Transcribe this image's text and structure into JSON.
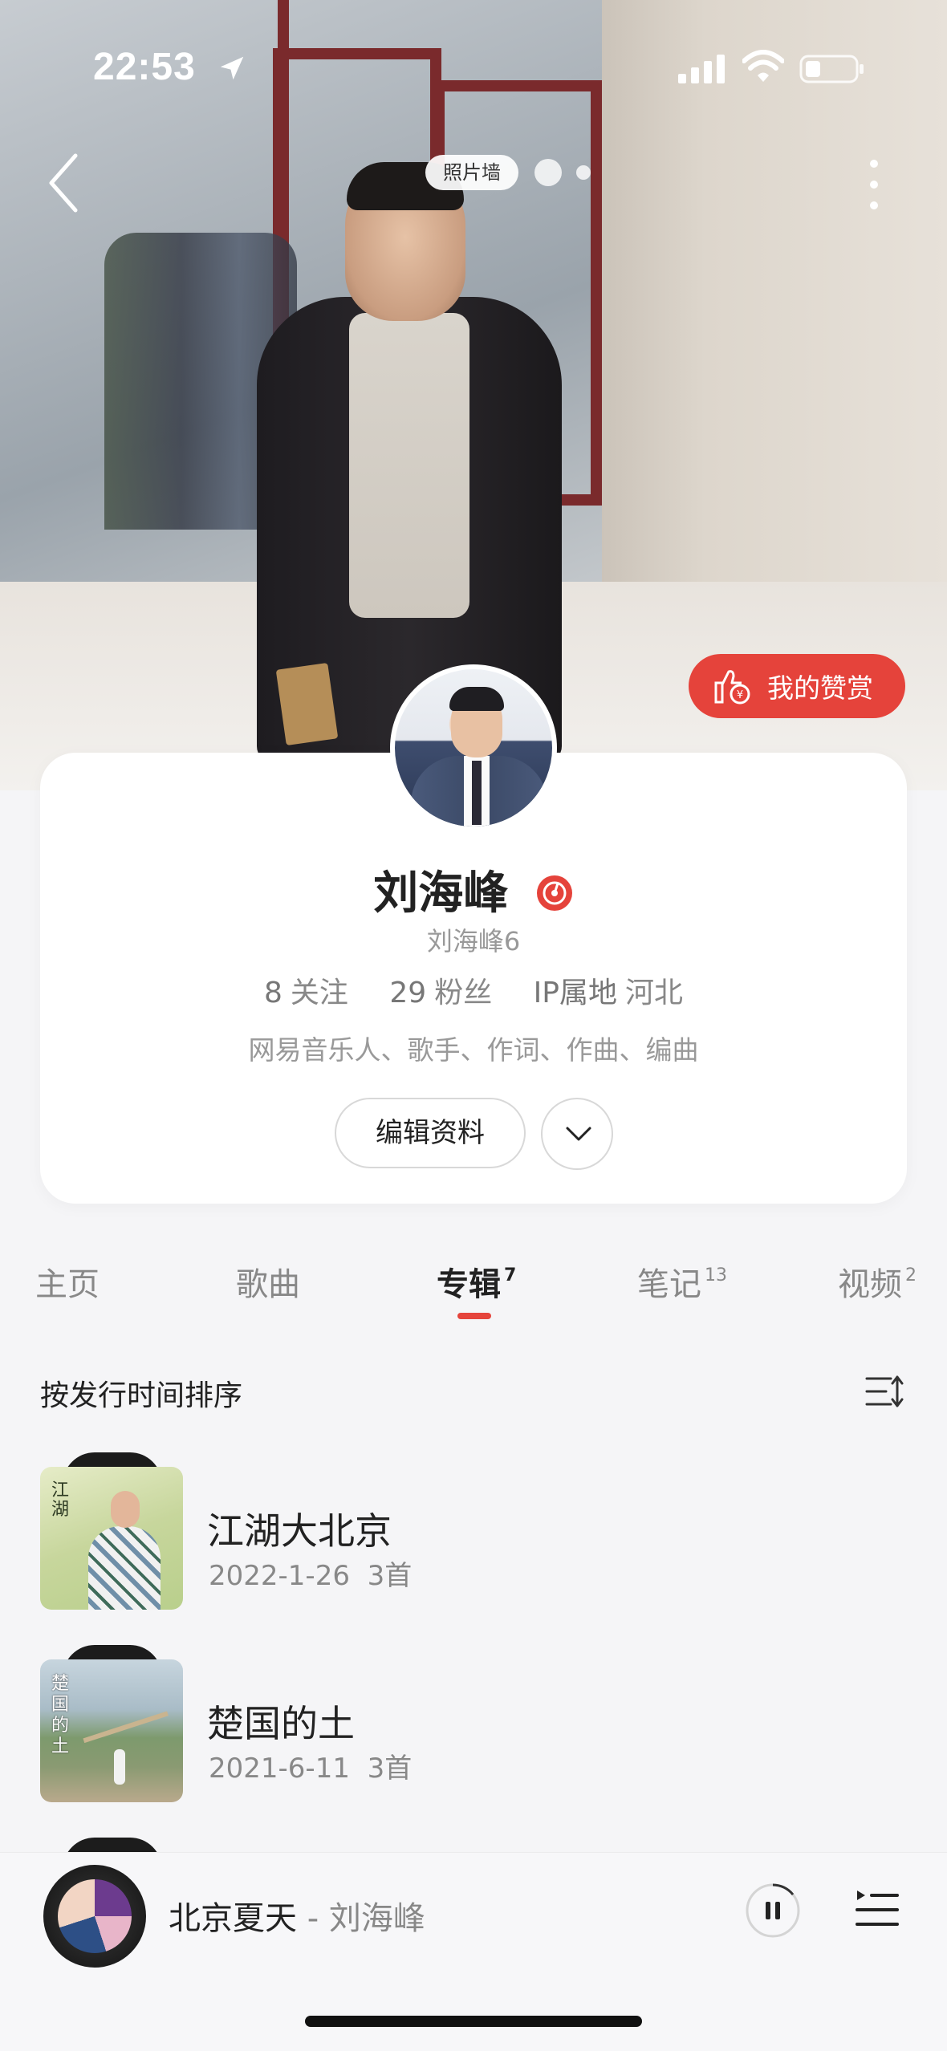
{
  "status_bar": {
    "time": "22:53"
  },
  "header": {
    "photo_wall_label": "照片墙"
  },
  "tip_button": {
    "label": "我的赞赏"
  },
  "profile": {
    "name": "刘海峰",
    "nickname": "刘海峰6",
    "following_count": "8",
    "following_label": "关注",
    "fans_count": "29",
    "fans_label": "粉丝",
    "ip_label": "IP属地",
    "ip_location": "河北",
    "description": "网易音乐人、歌手、作词、作曲、编曲",
    "edit_button": "编辑资料"
  },
  "tabs": [
    {
      "label": "主页",
      "count": ""
    },
    {
      "label": "歌曲",
      "count": ""
    },
    {
      "label": "专辑",
      "count": "7"
    },
    {
      "label": "笔记",
      "count": "13"
    },
    {
      "label": "视频",
      "count": "2"
    }
  ],
  "active_tab": "专辑",
  "sort": {
    "label": "按发行时间排序"
  },
  "albums": [
    {
      "title": "江湖大北京",
      "date": "2022-1-26",
      "tracks": "3首",
      "cover_text": "江湖"
    },
    {
      "title": "楚国的土",
      "date": "2021-6-11",
      "tracks": "3首",
      "cover_text": "楚国的土"
    }
  ],
  "player": {
    "song": "北京夏天",
    "separator": " - ",
    "artist": "刘海峰"
  },
  "colors": {
    "accent": "#e5433b"
  },
  "icons": [
    "location-arrow-icon",
    "signal-icon",
    "wifi-icon",
    "battery-icon",
    "back-icon",
    "more-icon",
    "thumbs-up-coin-icon",
    "musician-badge-icon",
    "chevron-down-icon",
    "sort-icon",
    "pause-icon",
    "playlist-icon"
  ]
}
